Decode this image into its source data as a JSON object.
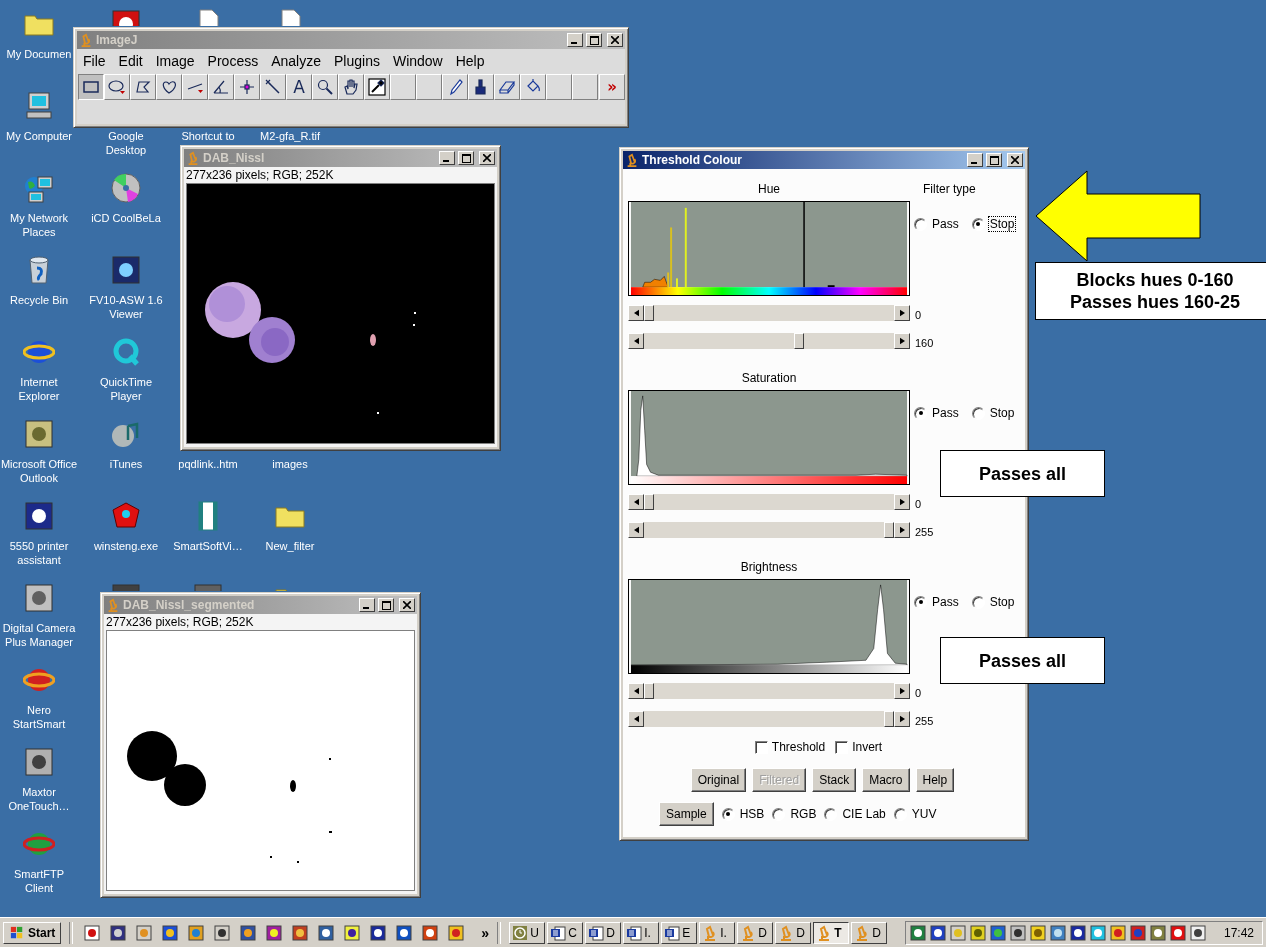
{
  "desktop_icons": [
    {
      "label": "My Documen"
    },
    {
      "label": "My Computer"
    },
    {
      "label": "Google Desktop"
    },
    {
      "label": "Shortcut to"
    },
    {
      "label": "M2-gfa_R.tif"
    },
    {
      "label": "My Network Places"
    },
    {
      "label": "iCD CoolBeLa"
    },
    {
      "label": "Recycle Bin"
    },
    {
      "label": "FV10-ASW 1.6 Viewer"
    },
    {
      "label": "Internet Explorer"
    },
    {
      "label": "QuickTime Player"
    },
    {
      "label": "Microsoft Office Outlook"
    },
    {
      "label": "iTunes"
    },
    {
      "label": "pqdlink..htm"
    },
    {
      "label": "images"
    },
    {
      "label": "5550 printer assistant"
    },
    {
      "label": "winsteng.exe"
    },
    {
      "label": "SmartSoftVi…"
    },
    {
      "label": "New_filter"
    },
    {
      "label": "Digital Camera Plus Manager"
    },
    {
      "label": "Nero StartSmart"
    },
    {
      "label": "Maxtor OneTouch…"
    },
    {
      "label": "SmartFTP Client"
    }
  ],
  "image_windows": [
    {
      "title": "DAB_Nissl",
      "info": "277x236 pixels; RGB; 252K",
      "active": false
    },
    {
      "title": "DAB_Nissl_segmented",
      "info": "277x236 pixels; RGB; 252K",
      "active": false
    }
  ],
  "imagej_window": {
    "title": "ImageJ",
    "active": false,
    "menu": [
      "File",
      "Edit",
      "Image",
      "Process",
      "Analyze",
      "Plugins",
      "Window",
      "Help"
    ],
    "tools": [
      {
        "selected": true
      },
      {
        "selected": false
      },
      {
        "selected": false
      },
      {
        "selected": false
      },
      {
        "selected": false
      },
      {
        "selected": false
      },
      {
        "selected": false
      },
      {
        "selected": false
      },
      {
        "glyph": "A",
        "selected": false
      },
      {
        "selected": false
      },
      {
        "selected": false
      },
      {
        "selected": false
      },
      {
        "selected": false
      },
      {
        "selected": false
      },
      {
        "selected": false
      },
      {
        "selected": false
      },
      {
        "selected": false
      },
      {
        "selected": false
      },
      {
        "selected": false
      },
      {
        "selected": false
      },
      {
        "glyph": "»",
        "selected": false
      }
    ]
  },
  "threshold_window": {
    "title": "Threshold Colour",
    "active": true,
    "filter_type_label": "Filter type",
    "channels": [
      {
        "name": "Hue",
        "options": [
          {
            "label": "Pass",
            "selected": false,
            "focused": false
          },
          {
            "label": "Stop",
            "selected": true,
            "focused": true
          }
        ],
        "sliders": [
          {
            "level": 0,
            "reading": "0"
          },
          {
            "level": 0.627,
            "reading": "160"
          }
        ]
      },
      {
        "name": "Saturation",
        "options": [
          {
            "label": "Pass",
            "selected": true,
            "focused": false
          },
          {
            "label": "Stop",
            "selected": false,
            "focused": false
          }
        ],
        "sliders": [
          {
            "level": 0,
            "reading": "0"
          },
          {
            "level": 1,
            "reading": "255"
          }
        ]
      },
      {
        "name": "Brightness",
        "options": [
          {
            "label": "Pass",
            "selected": true,
            "focused": false
          },
          {
            "label": "Stop",
            "selected": false,
            "focused": false
          }
        ],
        "sliders": [
          {
            "level": 0,
            "reading": "0"
          },
          {
            "level": 1,
            "reading": "255"
          }
        ]
      }
    ],
    "checkboxes": [
      {
        "label": "Threshold",
        "checked": false
      },
      {
        "label": "Invert",
        "checked": false
      }
    ],
    "buttons": [
      {
        "label": "Original",
        "disabled": false
      },
      {
        "label": "Filtered",
        "disabled": true
      },
      {
        "label": "Stack",
        "disabled": false
      },
      {
        "label": "Macro",
        "disabled": false
      },
      {
        "label": "Help",
        "disabled": false
      }
    ],
    "sample_button": "Sample",
    "color_spaces": [
      {
        "label": "HSB",
        "selected": true
      },
      {
        "label": "RGB",
        "selected": false
      },
      {
        "label": "CIE Lab",
        "selected": false
      },
      {
        "label": "YUV",
        "selected": false
      }
    ]
  },
  "callouts": [
    {
      "lines": [
        "Blocks hues 0-160",
        "Passes hues 160-25"
      ]
    },
    {
      "lines": [
        "Passes all"
      ]
    },
    {
      "lines": [
        "Passes all"
      ]
    }
  ],
  "taskbar": {
    "start": "Start",
    "more": "»",
    "tasks": [
      {
        "label": "U",
        "selected": false
      },
      {
        "label": "C",
        "selected": false
      },
      {
        "label": "D",
        "selected": false
      },
      {
        "label": "I.",
        "selected": false
      },
      {
        "label": "E",
        "selected": false
      },
      {
        "label": "I.",
        "selected": false
      },
      {
        "label": "D",
        "selected": false
      },
      {
        "label": "D",
        "selected": false
      },
      {
        "label": "T",
        "selected": true
      },
      {
        "label": "D",
        "selected": false
      }
    ],
    "clock": "17:42"
  }
}
